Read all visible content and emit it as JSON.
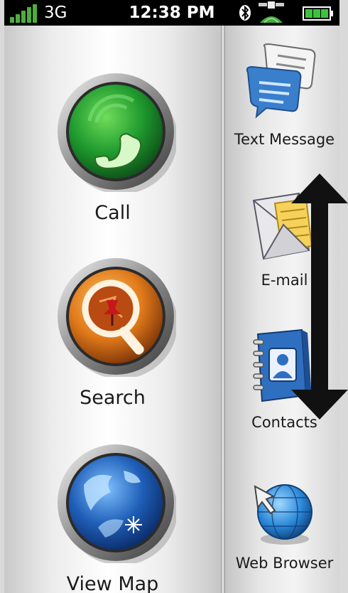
{
  "status_bar": {
    "network": "3G",
    "time": "12:38 PM",
    "icons": [
      "signal-icon",
      "bluetooth-icon",
      "gps-satellite-icon",
      "battery-icon"
    ]
  },
  "main_menu": [
    {
      "label": "Call",
      "icon": "phone-icon",
      "color": "#2e9e3a"
    },
    {
      "label": "Search",
      "icon": "map-pin-search-icon",
      "color": "#e07a1a"
    },
    {
      "label": "View Map",
      "icon": "globe-map-icon",
      "color": "#1f5fb8"
    }
  ],
  "side_menu": [
    {
      "label": "Text Message",
      "icon": "speech-bubbles-icon"
    },
    {
      "label": "E-mail",
      "icon": "envelope-icon"
    },
    {
      "label": "Contacts",
      "icon": "address-book-icon"
    },
    {
      "label": "Web Browser",
      "icon": "globe-cursor-icon"
    }
  ],
  "colors": {
    "status_bar": "#000000",
    "signal": "#4caf3a",
    "battery": "#3cc23c"
  }
}
